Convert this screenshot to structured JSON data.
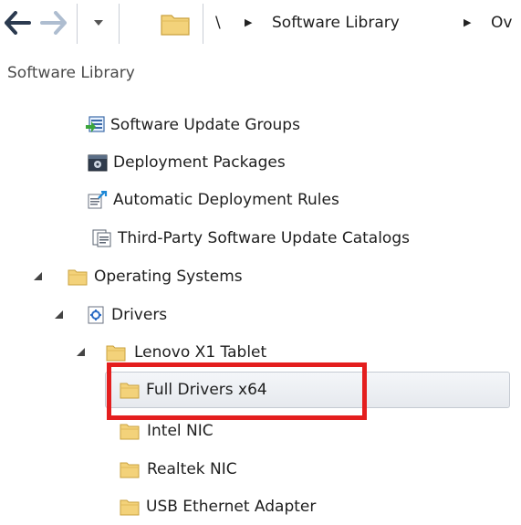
{
  "address_bar": {
    "back_icon": "arrow-left-icon",
    "forward_icon": "arrow-right-icon",
    "history_icon": "chevron-down-icon",
    "root_separator": "\\",
    "segments": [
      "Software Library",
      "Ov"
    ]
  },
  "pane": {
    "title": "Software Library"
  },
  "tree": {
    "items": [
      {
        "label": "Software Update Groups",
        "icon": "software-update-groups-icon"
      },
      {
        "label": "Deployment Packages",
        "icon": "deployment-packages-icon"
      },
      {
        "label": "Automatic Deployment Rules",
        "icon": "automatic-deployment-rules-icon"
      },
      {
        "label": "Third-Party Software Update Catalogs",
        "icon": "catalog-icon"
      },
      {
        "label": "Operating Systems",
        "icon": "folder-icon"
      },
      {
        "label": "Drivers",
        "icon": "drivers-icon"
      },
      {
        "label": "Lenovo X1 Tablet",
        "icon": "folder-icon"
      },
      {
        "label": "Full Drivers x64",
        "icon": "folder-icon",
        "selected": true
      },
      {
        "label": "Intel NIC",
        "icon": "folder-icon"
      },
      {
        "label": "Realtek NIC",
        "icon": "folder-icon"
      },
      {
        "label": "USB Ethernet Adapter",
        "icon": "folder-icon"
      }
    ]
  },
  "colors": {
    "highlight": "#e41e1e",
    "folder": "#f3d27a",
    "selection": "#e6e9ee"
  }
}
